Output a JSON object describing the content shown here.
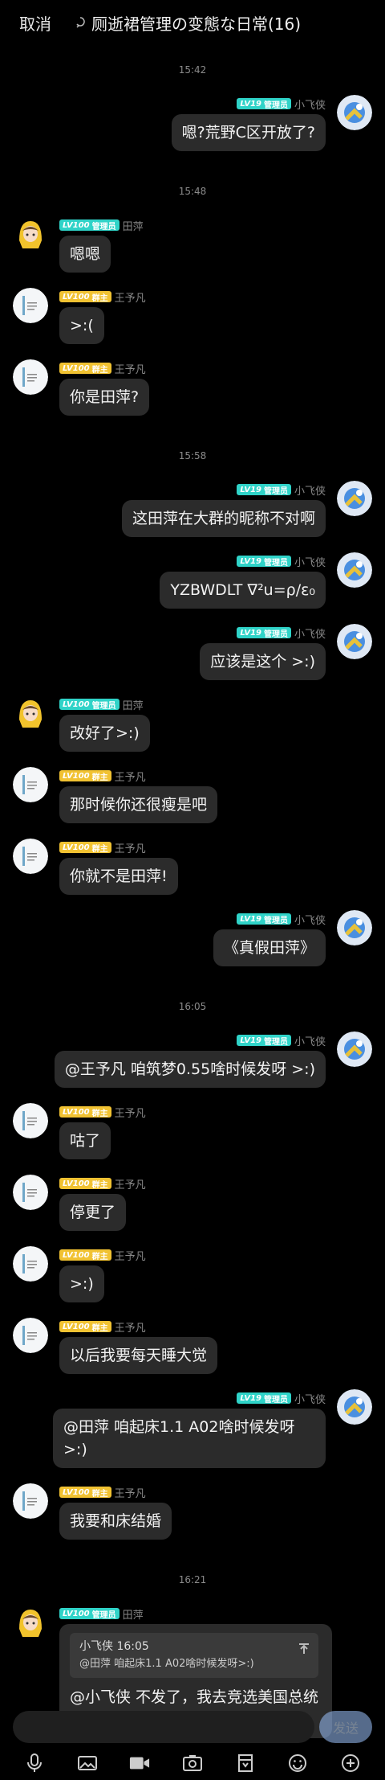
{
  "header": {
    "cancel": "取消",
    "title": "厕逝裙管理の变態な日常(16)"
  },
  "input": {
    "placeholder": "",
    "send": "发送"
  },
  "colors": {
    "admin_badge": "#2fd3c8",
    "member_badge": "#f1c232",
    "bubble": "#2b2b2b",
    "send_button": "#8fb3e8"
  },
  "messages": [
    {
      "type": "time",
      "text": "15:42"
    },
    {
      "type": "msg",
      "side": "right",
      "avatar": "xiaofeixia-avatar",
      "level": "LV19",
      "role": "管理员",
      "name": "小飞侠",
      "text": "嗯?荒野C区开放了?"
    },
    {
      "type": "time",
      "text": "15:48"
    },
    {
      "type": "msg",
      "side": "left",
      "avatar": "tianping-avatar",
      "level": "LV100",
      "role": "管理员",
      "name": "田萍",
      "text": "嗯嗯"
    },
    {
      "type": "msg",
      "side": "left",
      "avatar": "wangyufan-avatar",
      "level": "LV100",
      "role": "群主",
      "name": "王予凡",
      "text": ">:("
    },
    {
      "type": "msg",
      "side": "left",
      "avatar": "wangyufan-avatar",
      "level": "LV100",
      "role": "群主",
      "name": "王予凡",
      "text": "你是田萍?"
    },
    {
      "type": "time",
      "text": "15:58"
    },
    {
      "type": "msg",
      "side": "right",
      "avatar": "xiaofeixia-avatar",
      "level": "LV19",
      "role": "管理员",
      "name": "小飞侠",
      "text": "这田萍在大群的昵称不对啊"
    },
    {
      "type": "msg",
      "side": "right",
      "avatar": "xiaofeixia-avatar",
      "level": "LV19",
      "role": "管理员",
      "name": "小飞侠",
      "text": "YZBWDLT ∇²u=ρ/ε₀"
    },
    {
      "type": "msg",
      "side": "right",
      "avatar": "xiaofeixia-avatar",
      "level": "LV19",
      "role": "管理员",
      "name": "小飞侠",
      "text": "应该是这个 >:)"
    },
    {
      "type": "msg",
      "side": "left",
      "avatar": "tianping-avatar",
      "level": "LV100",
      "role": "管理员",
      "name": "田萍",
      "text": "改好了>:)"
    },
    {
      "type": "msg",
      "side": "left",
      "avatar": "wangyufan-avatar",
      "level": "LV100",
      "role": "群主",
      "name": "王予凡",
      "text": "那时候你还很瘦是吧"
    },
    {
      "type": "msg",
      "side": "left",
      "avatar": "wangyufan-avatar",
      "level": "LV100",
      "role": "群主",
      "name": "王予凡",
      "text": "你就不是田萍!"
    },
    {
      "type": "msg",
      "side": "right",
      "avatar": "xiaofeixia-avatar",
      "level": "LV19",
      "role": "管理员",
      "name": "小飞侠",
      "text": "《真假田萍》"
    },
    {
      "type": "time",
      "text": "16:05"
    },
    {
      "type": "msg",
      "side": "right",
      "avatar": "xiaofeixia-avatar",
      "level": "LV19",
      "role": "管理员",
      "name": "小飞侠",
      "text": "@王予凡 咱筑梦0.55啥时候发呀 >:)"
    },
    {
      "type": "msg",
      "side": "left",
      "avatar": "wangyufan-avatar",
      "level": "LV100",
      "role": "群主",
      "name": "王予凡",
      "text": "咕了"
    },
    {
      "type": "msg",
      "side": "left",
      "avatar": "wangyufan-avatar",
      "level": "LV100",
      "role": "群主",
      "name": "王予凡",
      "text": "停更了"
    },
    {
      "type": "msg",
      "side": "left",
      "avatar": "wangyufan-avatar",
      "level": "LV100",
      "role": "群主",
      "name": "王予凡",
      "text": ">:)"
    },
    {
      "type": "msg",
      "side": "left",
      "avatar": "wangyufan-avatar",
      "level": "LV100",
      "role": "群主",
      "name": "王予凡",
      "text": "以后我要每天睡大觉"
    },
    {
      "type": "msg",
      "side": "right",
      "avatar": "xiaofeixia-avatar",
      "level": "LV19",
      "role": "管理员",
      "name": "小飞侠",
      "text": "@田萍 咱起床1.1 A02啥时候发呀>:)"
    },
    {
      "type": "msg",
      "side": "left",
      "avatar": "wangyufan-avatar",
      "level": "LV100",
      "role": "群主",
      "name": "王予凡",
      "text": "我要和床结婚"
    },
    {
      "type": "time",
      "text": "16:21"
    },
    {
      "type": "msg",
      "side": "left",
      "avatar": "tianping-avatar",
      "level": "LV100",
      "role": "管理员",
      "name": "田萍",
      "reply": {
        "head": "小飞侠 16:05",
        "body": "@田萍 咱起床1.1 A02啥时候发呀>:)"
      },
      "text": "@小飞侠 不发了，我去竞选美国总统了，在选上之前所有地图都鸽掉"
    }
  ],
  "toolbar": [
    "voice-icon",
    "image-icon",
    "video-icon",
    "camera-icon",
    "file-icon",
    "emoji-icon",
    "plus-icon"
  ]
}
